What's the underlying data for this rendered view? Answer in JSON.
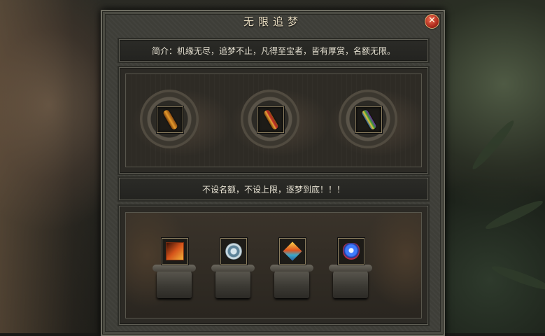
{
  "window": {
    "title": "无限追梦",
    "close_icon": "close-icon"
  },
  "intro": {
    "text": "简介：机缘无尽，追梦不止，凡得至宝者，皆有厚赏，名额无限。"
  },
  "rewards_top": [
    {
      "icon": "golden-scroll-icon"
    },
    {
      "icon": "red-gold-scroll-icon"
    },
    {
      "icon": "rainbow-scroll-icon"
    }
  ],
  "banner": {
    "text": "不设名额，不设上限，逐梦到底！！！"
  },
  "rewards_bottom": [
    {
      "icon": "fire-tome-icon"
    },
    {
      "icon": "rune-disc-icon"
    },
    {
      "icon": "prism-crystal-icon"
    },
    {
      "icon": "winged-emblem-icon"
    }
  ],
  "colors": {
    "panel": "#3e3e38",
    "border": "#6e6d62",
    "text": "#e6e1d2",
    "close_button": "#c0392b"
  }
}
